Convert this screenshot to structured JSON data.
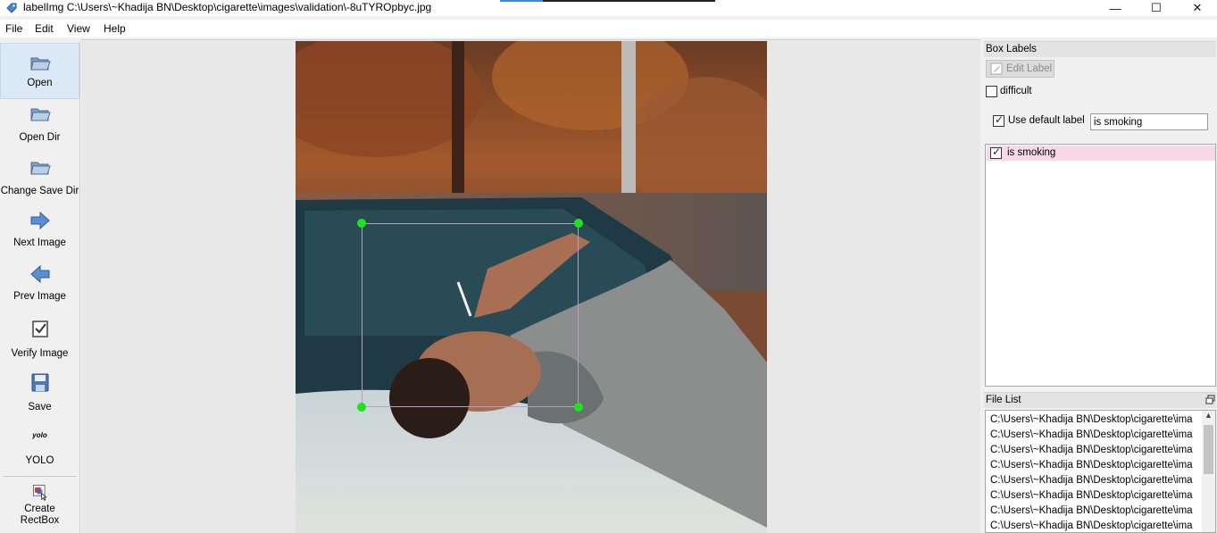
{
  "window": {
    "title": "labelImg C:\\Users\\~Khadija BN\\Desktop\\cigarette\\images\\validation\\-8uTYROpbyc.jpg",
    "minimize_glyph": "—",
    "maximize_glyph": "☐",
    "close_glyph": "✕"
  },
  "menu": [
    "File",
    "Edit",
    "View",
    "Help"
  ],
  "toolbar": {
    "items": [
      {
        "label": "Open",
        "icon": "open-folder-icon"
      },
      {
        "label": "Open Dir",
        "icon": "open-dir-icon"
      },
      {
        "label": "Change Save Dir",
        "icon": "change-save-dir-icon"
      },
      {
        "label": "Next Image",
        "icon": "arrow-right-icon"
      },
      {
        "label": "Prev Image",
        "icon": "arrow-left-icon"
      },
      {
        "label": "Verify Image",
        "icon": "verify-icon"
      },
      {
        "label": "Save",
        "icon": "save-disk-icon"
      },
      {
        "label": "YOLO",
        "icon": "yolo-format-icon",
        "icon_text": "yolo"
      },
      {
        "label": "Create\nRectBox",
        "icon": "create-rectbox-icon"
      }
    ]
  },
  "canvas": {
    "annotation_label": "is smoking",
    "box_color": "#b99ec9",
    "handle_color": "#1ee21e"
  },
  "box_labels_panel": {
    "title": "Box Labels",
    "edit_label_button": "Edit Label",
    "difficult_label": "difficult",
    "difficult_checked": false,
    "use_default_label_text": "Use default label",
    "use_default_label_checked": true,
    "default_label_value": "is smoking",
    "labels": [
      {
        "text": "is smoking",
        "checked": true,
        "highlight": "#f8d8e6"
      }
    ]
  },
  "file_list_panel": {
    "title": "File List",
    "files": [
      "C:\\Users\\~Khadija BN\\Desktop\\cigarette\\ima",
      "C:\\Users\\~Khadija BN\\Desktop\\cigarette\\ima",
      "C:\\Users\\~Khadija BN\\Desktop\\cigarette\\ima",
      "C:\\Users\\~Khadija BN\\Desktop\\cigarette\\ima",
      "C:\\Users\\~Khadija BN\\Desktop\\cigarette\\ima",
      "C:\\Users\\~Khadija BN\\Desktop\\cigarette\\ima",
      "C:\\Users\\~Khadija BN\\Desktop\\cigarette\\ima",
      "C:\\Users\\~Khadija BN\\Desktop\\cigarette\\ima"
    ]
  }
}
